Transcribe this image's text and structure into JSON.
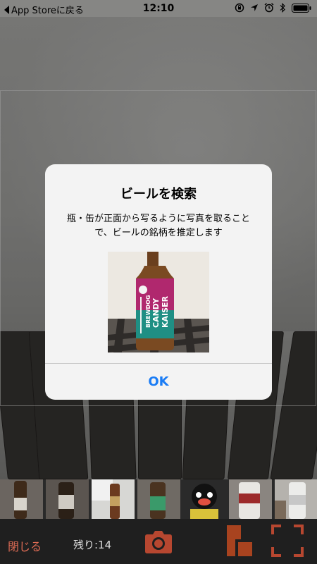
{
  "status_bar": {
    "back_label": "App Storeに戻る",
    "time": "12:10",
    "icons": [
      "screen-rotation-lock-icon",
      "location-arrow-icon",
      "alarm-icon",
      "bluetooth-icon",
      "battery-icon"
    ]
  },
  "alert": {
    "title": "ビールを検索",
    "message": "瓶・缶が正面から写るように写真を取ることで、ビールの銘柄を推定します",
    "photo": {
      "brand": "BREWDOG",
      "product_line1": "CANDY",
      "product_line2": "KAISER"
    },
    "ok_label": "OK"
  },
  "thumbnails": [
    {
      "name": "thumb-1"
    },
    {
      "name": "thumb-2"
    },
    {
      "name": "thumb-3"
    },
    {
      "name": "thumb-4"
    },
    {
      "name": "thumb-5"
    },
    {
      "name": "thumb-6"
    },
    {
      "name": "thumb-7"
    }
  ],
  "toolbar": {
    "close_label": "閉じる",
    "remaining_label": "残り:14",
    "camera_icon": "camera-icon",
    "gallery_icon": "gallery-icon",
    "focus_icon": "focus-frame-icon"
  },
  "colors": {
    "accent_red": "#e06c55",
    "camera_icon": "#b74730",
    "ok_blue": "#1a7cf5"
  }
}
